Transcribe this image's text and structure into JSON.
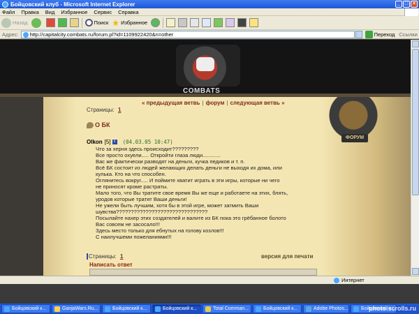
{
  "window": {
    "title": "Бойцовский клуб - Microsoft Internet Explorer"
  },
  "menu": {
    "items": [
      "Файл",
      "Правка",
      "Вид",
      "Избранное",
      "Сервис",
      "Справка"
    ]
  },
  "toolbar": {
    "back_label": "Назад",
    "search_label": "Поиск",
    "favorites_label": "Избранное"
  },
  "address": {
    "label": "Адрес:",
    "url": "http://capitalcity.combats.ru/forum.pl?id=1109922420&n=other",
    "go_label": "Переход",
    "links_label": "Ссылки"
  },
  "site": {
    "logo_text": "COMBATS",
    "forum_badge": "ФОРУМ",
    "nav": {
      "prev": "« предыдущая ветвь",
      "forum": "форум",
      "next": "следующая ветвь »"
    }
  },
  "pagination": {
    "label": "Страницы:",
    "current": "1"
  },
  "topic": {
    "title": "О БК"
  },
  "post": {
    "author": "Olkon",
    "level": "[5]",
    "info_icon": "i",
    "date": "(04.03.05 10:47)",
    "lines": [
      "Что за херня здесь происходит?????????",
      "Все просто охуели..... Откройти глаза люди............",
      "Вас же фактически разводят на деньги, кучка педиков и т. п.",
      "Всё БК состоит из людей желающих делать деньги не выходя их дома, или",
      "кулька. Кто на что способен.",
      "Оглянитесь вокруг..... И поймите хватит играть в эти игры, которые ни чего",
      "не приносят кроме растраты.",
      "Мало того, что Вы тратите свое время Вы же еще и работаете на этих, блять,",
      "уродов которые тратят Ваши деньги!",
      "Не ужели быть лучшим, хотя бы в этой игре, может затмить Ваши",
      "шувства???????????????????????????????",
      "Посылайте нахер этих создателей и валите из БК пока это грёбанное болото",
      "Вас совсем не засосало!!!",
      "Здесь место только для ебнутых на голову козлов!!!",
      "С наилучшеми пожеланиями!!!"
    ]
  },
  "print_version": "версия для печати",
  "reply": {
    "title": "Написать ответ",
    "corner_label": "✕"
  },
  "status": {
    "zone": "Интернет"
  },
  "taskbar": {
    "tasks": [
      {
        "label": "Бойцовский к...",
        "icon": "ie"
      },
      {
        "label": "GanjaWars.Ru...",
        "icon": "gw"
      },
      {
        "label": "Бойцовский к...",
        "icon": "ie"
      },
      {
        "label": "Бойцовский к...",
        "icon": "ie",
        "active": true
      },
      {
        "label": "Total Comman...",
        "icon": "tc"
      },
      {
        "label": "Бойцовский к...",
        "icon": "ie"
      },
      {
        "label": "Adobe Photos...",
        "icon": "ps"
      },
      {
        "label": "Бойцовский к...",
        "icon": "ie"
      }
    ],
    "watermark": "photo.scrolls.ru"
  }
}
